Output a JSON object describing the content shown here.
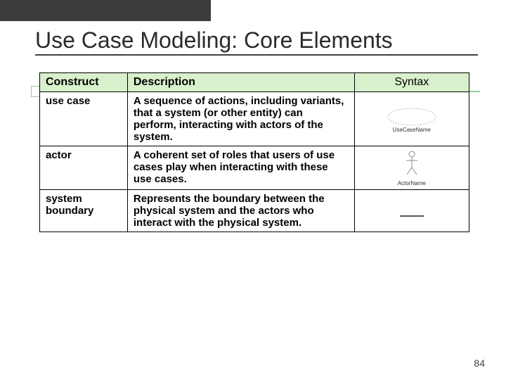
{
  "title": "Use Case Modeling: Core Elements",
  "page_number": "84",
  "headers": {
    "construct": "Construct",
    "description": "Description",
    "syntax": "Syntax"
  },
  "rows": [
    {
      "construct": "use case",
      "description": "A sequence of actions, including variants, that a system (or other entity) can perform, interacting with actors of the system.",
      "syntax_label": "UseCaseName"
    },
    {
      "construct": "actor",
      "description": "A coherent set of roles that users of use cases play when interacting with these use cases.",
      "syntax_label": "ActorName"
    },
    {
      "construct": "system boundary",
      "description": "Represents the boundary between the physical system and the actors who interact with the physical system.",
      "syntax_label": ""
    }
  ]
}
